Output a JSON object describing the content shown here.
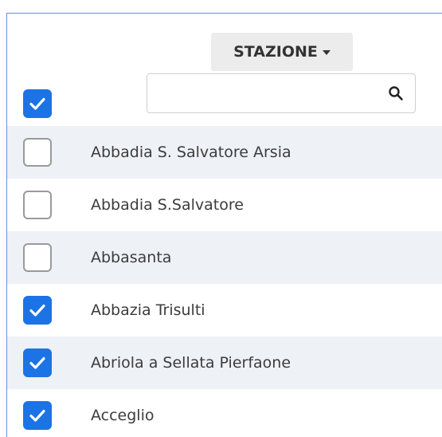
{
  "header": {
    "column_label": "STAZIONE"
  },
  "search": {
    "value": "",
    "placeholder": ""
  },
  "select_all": {
    "checked": true
  },
  "stations": [
    {
      "label": "Abbadia S. Salvatore Arsia",
      "checked": false
    },
    {
      "label": "Abbadia S.Salvatore",
      "checked": false
    },
    {
      "label": "Abbasanta",
      "checked": false
    },
    {
      "label": "Abbazia Trisulti",
      "checked": true
    },
    {
      "label": "Abriola a Sellata Pierfaone",
      "checked": true
    },
    {
      "label": "Acceglio",
      "checked": true
    }
  ],
  "colors": {
    "accent": "#1b73e6",
    "row_stripe": "#eef1f6",
    "frame_border": "#6b8ed0"
  }
}
